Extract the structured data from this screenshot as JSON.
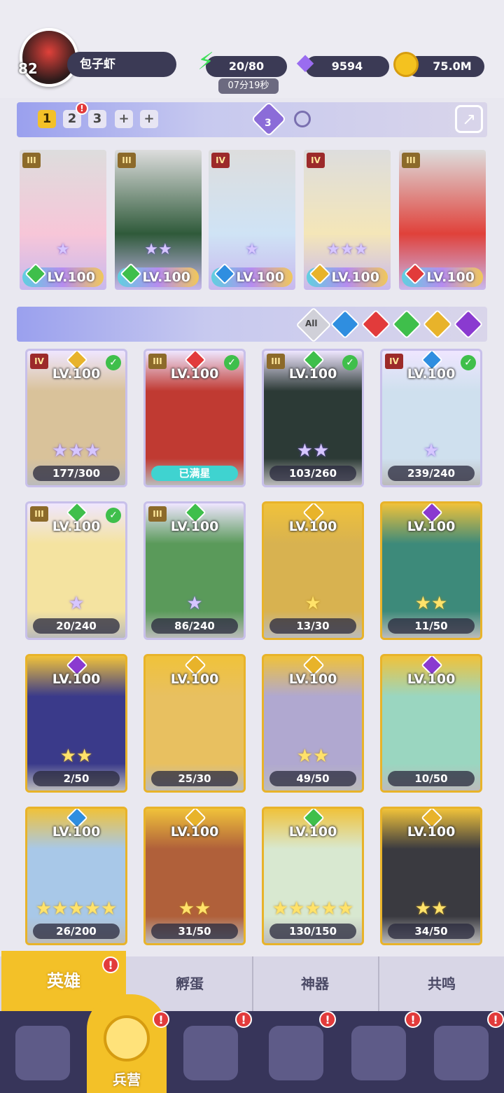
{
  "player": {
    "level": "82",
    "name": "包子虾"
  },
  "resources": {
    "energy": "20/80",
    "energy_timer": "07分19秒",
    "gems": "9594",
    "gold": "75.0M"
  },
  "team_tabs": [
    "1",
    "2",
    "3",
    "+",
    "+"
  ],
  "team_count": "3",
  "team": [
    {
      "tier": "III",
      "level": "LV.100",
      "stars": "★",
      "color": "#f7c6d8",
      "element": "#3fbf4b"
    },
    {
      "tier": "III",
      "level": "LV.100",
      "stars": "★★",
      "color": "#2f5a3a",
      "element": "#3fbf4b"
    },
    {
      "tier": "IV",
      "level": "LV.100",
      "stars": "★",
      "color": "#cfe3f5",
      "element": "#2f8ee0"
    },
    {
      "tier": "IV",
      "level": "LV.100",
      "stars": "★★★",
      "color": "#f4e6b8",
      "element": "#e8b32a"
    },
    {
      "tier": "III",
      "level": "LV.100",
      "stars": "",
      "color": "#e0413a",
      "element": "#e23b3b"
    }
  ],
  "filters": [
    "All"
  ],
  "heroes": [
    {
      "tier": "IV",
      "level": "LV.100",
      "progress": "177/300",
      "stars": "★★★",
      "checked": true,
      "gold": false,
      "color": "#d9c29a",
      "element": "#e8b32a"
    },
    {
      "tier": "III",
      "level": "LV.100",
      "progress": "已满星",
      "stars": "",
      "checked": true,
      "gold": false,
      "max": true,
      "color": "#c03a32",
      "element": "#e23b3b"
    },
    {
      "tier": "III",
      "level": "LV.100",
      "progress": "103/260",
      "stars": "★★",
      "checked": true,
      "gold": false,
      "color": "#2c3a36",
      "element": "#3fbf4b"
    },
    {
      "tier": "IV",
      "level": "LV.100",
      "progress": "239/240",
      "stars": "★",
      "checked": true,
      "gold": false,
      "color": "#cfe0ee",
      "element": "#2f8ee0"
    },
    {
      "tier": "III",
      "level": "LV.100",
      "progress": "20/240",
      "stars": "★",
      "checked": true,
      "gold": false,
      "color": "#f4e3a0",
      "element": "#3fbf4b"
    },
    {
      "tier": "III",
      "level": "LV.100",
      "progress": "86/240",
      "stars": "★",
      "checked": false,
      "gold": false,
      "color": "#5a9a5a",
      "element": "#3fbf4b"
    },
    {
      "tier": "",
      "level": "LV.100",
      "progress": "13/30",
      "stars": "★",
      "checked": false,
      "gold": true,
      "color": "#d8b250",
      "element": "#e8b32a"
    },
    {
      "tier": "",
      "level": "LV.100",
      "progress": "11/50",
      "stars": "★★",
      "checked": false,
      "gold": true,
      "color": "#3d8a7a",
      "element": "#8a3ad0"
    },
    {
      "tier": "",
      "level": "LV.100",
      "progress": "2/50",
      "stars": "★★",
      "checked": false,
      "gold": true,
      "color": "#3a3a8a",
      "element": "#8a3ad0"
    },
    {
      "tier": "",
      "level": "LV.100",
      "progress": "25/30",
      "stars": "",
      "checked": false,
      "gold": true,
      "color": "#e8c060",
      "element": "#e8b32a"
    },
    {
      "tier": "",
      "level": "LV.100",
      "progress": "49/50",
      "stars": "★★",
      "checked": false,
      "gold": true,
      "color": "#b0a8d0",
      "element": "#e8b32a"
    },
    {
      "tier": "",
      "level": "LV.100",
      "progress": "10/50",
      "stars": "",
      "checked": false,
      "gold": true,
      "color": "#9ad6c0",
      "element": "#8a3ad0"
    },
    {
      "tier": "",
      "level": "LV.100",
      "progress": "26/200",
      "stars": "★★★★★",
      "checked": false,
      "gold": true,
      "color": "#a8c8e8",
      "element": "#2f8ee0"
    },
    {
      "tier": "",
      "level": "LV.100",
      "progress": "31/50",
      "stars": "★★",
      "checked": false,
      "gold": true,
      "color": "#b0603a",
      "element": "#e8b32a"
    },
    {
      "tier": "",
      "level": "LV.100",
      "progress": "130/150",
      "stars": "★★★★★",
      "checked": false,
      "gold": true,
      "color": "#d8e8d0",
      "element": "#3fbf4b"
    },
    {
      "tier": "",
      "level": "LV.100",
      "progress": "34/50",
      "stars": "★★",
      "checked": false,
      "gold": true,
      "color": "#3a3a40",
      "element": "#e8b32a"
    }
  ],
  "tabs": [
    "英雄",
    "孵蛋",
    "神器",
    "共鸣"
  ],
  "bottom_nav": {
    "active_label": "兵营"
  }
}
